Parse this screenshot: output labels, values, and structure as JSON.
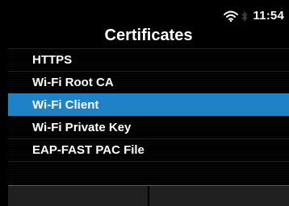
{
  "colors": {
    "background": "#000000",
    "text": "#ffffff",
    "selection": "#1d82c6",
    "softkey_bar": "#202020"
  },
  "status_bar": {
    "time": "11:54",
    "icons": [
      "wifi-icon",
      "bluetooth-icon"
    ]
  },
  "screen": {
    "title": "Certificates"
  },
  "menu": {
    "selected_index": 2,
    "items": [
      {
        "label": "HTTPS"
      },
      {
        "label": "Wi-Fi Root CA"
      },
      {
        "label": "Wi-Fi Client"
      },
      {
        "label": "Wi-Fi Private Key"
      },
      {
        "label": "EAP-FAST PAC File"
      }
    ]
  },
  "softkeys": {
    "left": "",
    "right": ""
  }
}
